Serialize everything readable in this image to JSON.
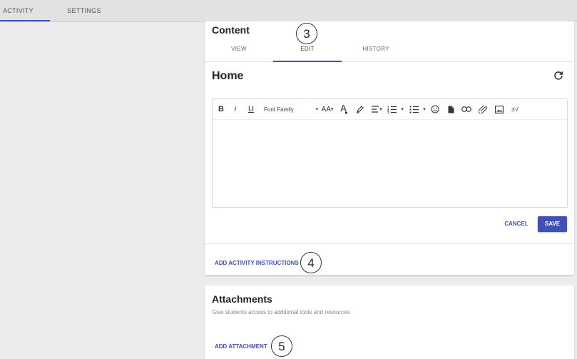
{
  "topbar": {
    "tabs": [
      {
        "label": "ACTIVITY",
        "active": true
      },
      {
        "label": "SETTINGS",
        "active": false
      }
    ]
  },
  "content_card": {
    "title": "Content",
    "tabs": [
      {
        "label": "VIEW"
      },
      {
        "label": "EDIT",
        "active": true
      },
      {
        "label": "HISTORY"
      }
    ],
    "page_title": "Home",
    "editor": {
      "toolbar": {
        "bold": "B",
        "italic": "i",
        "underline": "U",
        "font_family": "Font Family",
        "font_size": "AA",
        "special_char": "±√"
      }
    },
    "cancel_label": "CANCEL",
    "save_label": "SAVE",
    "add_instructions_label": "ADD ACTIVITY INSTRUCTIONS"
  },
  "attachments_card": {
    "title": "Attachments",
    "subtitle": "Give students access to additional tools and resources",
    "add_attachment_label": "ADD ATTACHMENT"
  },
  "callouts": [
    "3",
    "4",
    "5"
  ],
  "colors": {
    "accent": "#3f51b5"
  }
}
